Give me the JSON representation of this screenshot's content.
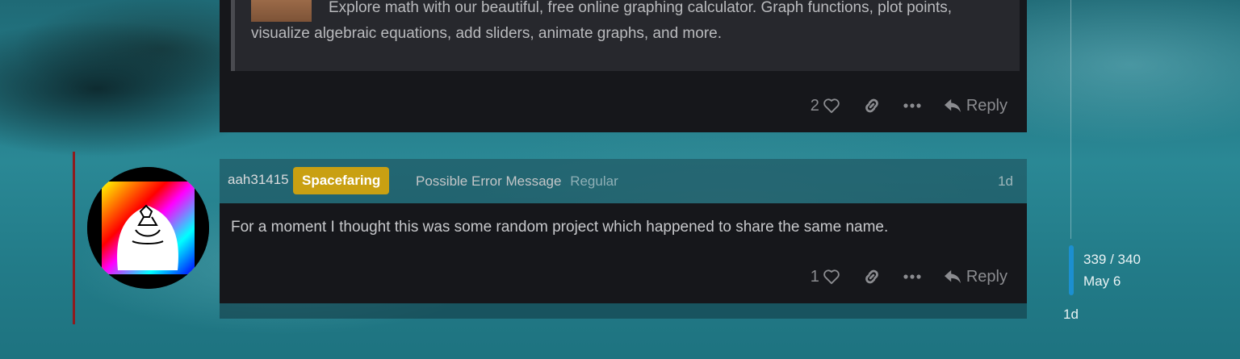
{
  "previous_post": {
    "onebox_description": "Explore math with our beautiful, free online graphing calculator. Graph functions, plot points, visualize algebraic equations, add sliders, animate graphs, and more.",
    "like_count": "2",
    "reply_label": "Reply"
  },
  "post": {
    "username": "aah31415",
    "flair": "Spacefaring",
    "user_title": "Possible Error Message",
    "user_group": "Regular",
    "date": "1d",
    "text": "For a moment I thought this was some random project which happened to share the same name.",
    "like_count": "1",
    "reply_label": "Reply"
  },
  "timeline": {
    "count": "339 / 340",
    "date": "May 6",
    "end_label": "1d"
  },
  "colors": {
    "post_background": "#16171b",
    "flair_background": "#c9a012",
    "timeline_handle": "#1c8fd0",
    "avatar_accent_line": "#8e1b1e"
  },
  "icons": [
    "heart-icon",
    "link-icon",
    "more-icon",
    "reply-icon"
  ]
}
